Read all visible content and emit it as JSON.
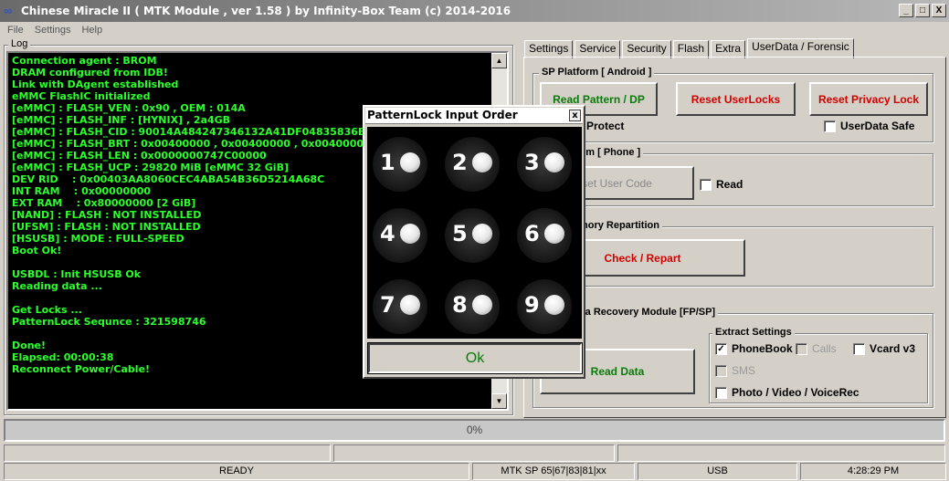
{
  "window": {
    "title": "Chinese Miracle II ( MTK Module , ver 1.58 ) by Infinity-Box Team (c) 2014-2016",
    "icon": "infinity-icon",
    "minimize": "_",
    "maximize": "□",
    "close": "X"
  },
  "menu": [
    "File",
    "Settings",
    "Help"
  ],
  "log": {
    "label": "Log",
    "lines": "Connection agent : BROM\nDRAM configured from IDB!\nLink with DAgent established\neMMC FlashIC initialized\n[eMMC] : FLASH_VEN : 0x90 , OEM : 014A\n[eMMC] : FLASH_INF : [HYNIX] , 2a4GB\n[eMMC] : FLASH_CID : 90014A484247346132A41DF04835836B\n[eMMC] : FLASH_BRT : 0x00400000 , 0x00400000 , 0x00400000\n[eMMC] : FLASH_LEN : 0x0000000747C00000\n[eMMC] : FLASH_UCP : 29820 MiB [eMMC 32 GiB]\nDEV RID    : 0x00403AA8060CEC4ABA54B36D5214A68C\nINT RAM    : 0x00000000\nEXT RAM    : 0x80000000 [2 GiB]\n[NAND] : FLASH : NOT INSTALLED\n[UFSM] : FLASH : NOT INSTALLED\n[HSUSB] : MODE : FULL-SPEED\nBoot Ok!\n\nUSBDL : Init HSUSB Ok\nReading data ...\n\nGet Locks ...\nPatternLock Sequnce : 321598746\n\nDone!\nElapsed: 00:00:38\nReconnect Power/Cable!"
  },
  "tabs": [
    "Settings",
    "Service",
    "Security",
    "Flash",
    "Extra",
    "UserData / Forensic"
  ],
  "active_tab": "UserData / Forensic",
  "sp_android": {
    "label": "SP Platform [ Android ]",
    "read_pattern": "Read Pattern / DP",
    "reset_userlocks": "Reset UserLocks",
    "reset_privacy": "Reset Privacy Lock",
    "protect_label": "Protect",
    "userdata_safe": "UserData Safe",
    "userdata_safe_checked": false
  },
  "sp_phone": {
    "label": "rm [ Phone ]",
    "reset_user_code": "set User Code",
    "read_label": "Read",
    "read_checked": false
  },
  "repartition": {
    "label": "nory Repartition",
    "check_repart": "Check / Repart"
  },
  "recovery": {
    "label": "ta Recovery Module  [FP/SP]",
    "read_data": "Read Data",
    "extract_label": "Extract Settings",
    "phonebook": "PhoneBook",
    "phonebook_checked": true,
    "calls": "Calls",
    "calls_checked": false,
    "vcard": "Vcard v3",
    "vcard_checked": false,
    "sms": "SMS",
    "sms_checked": false,
    "photo": "Photo / Video / VoiceRec",
    "photo_checked": false
  },
  "progress": {
    "text": "0%",
    "value": 0
  },
  "statusbar": {
    "state": "READY",
    "platform": "MTK SP 65|67|83|81|xx",
    "port": "USB",
    "time": "4:28:29 PM"
  },
  "dialog": {
    "title": "PatternLock Input Order",
    "close": "x",
    "nodes": [
      "1",
      "2",
      "3",
      "4",
      "5",
      "6",
      "7",
      "8",
      "9"
    ],
    "ok": "Ok"
  }
}
